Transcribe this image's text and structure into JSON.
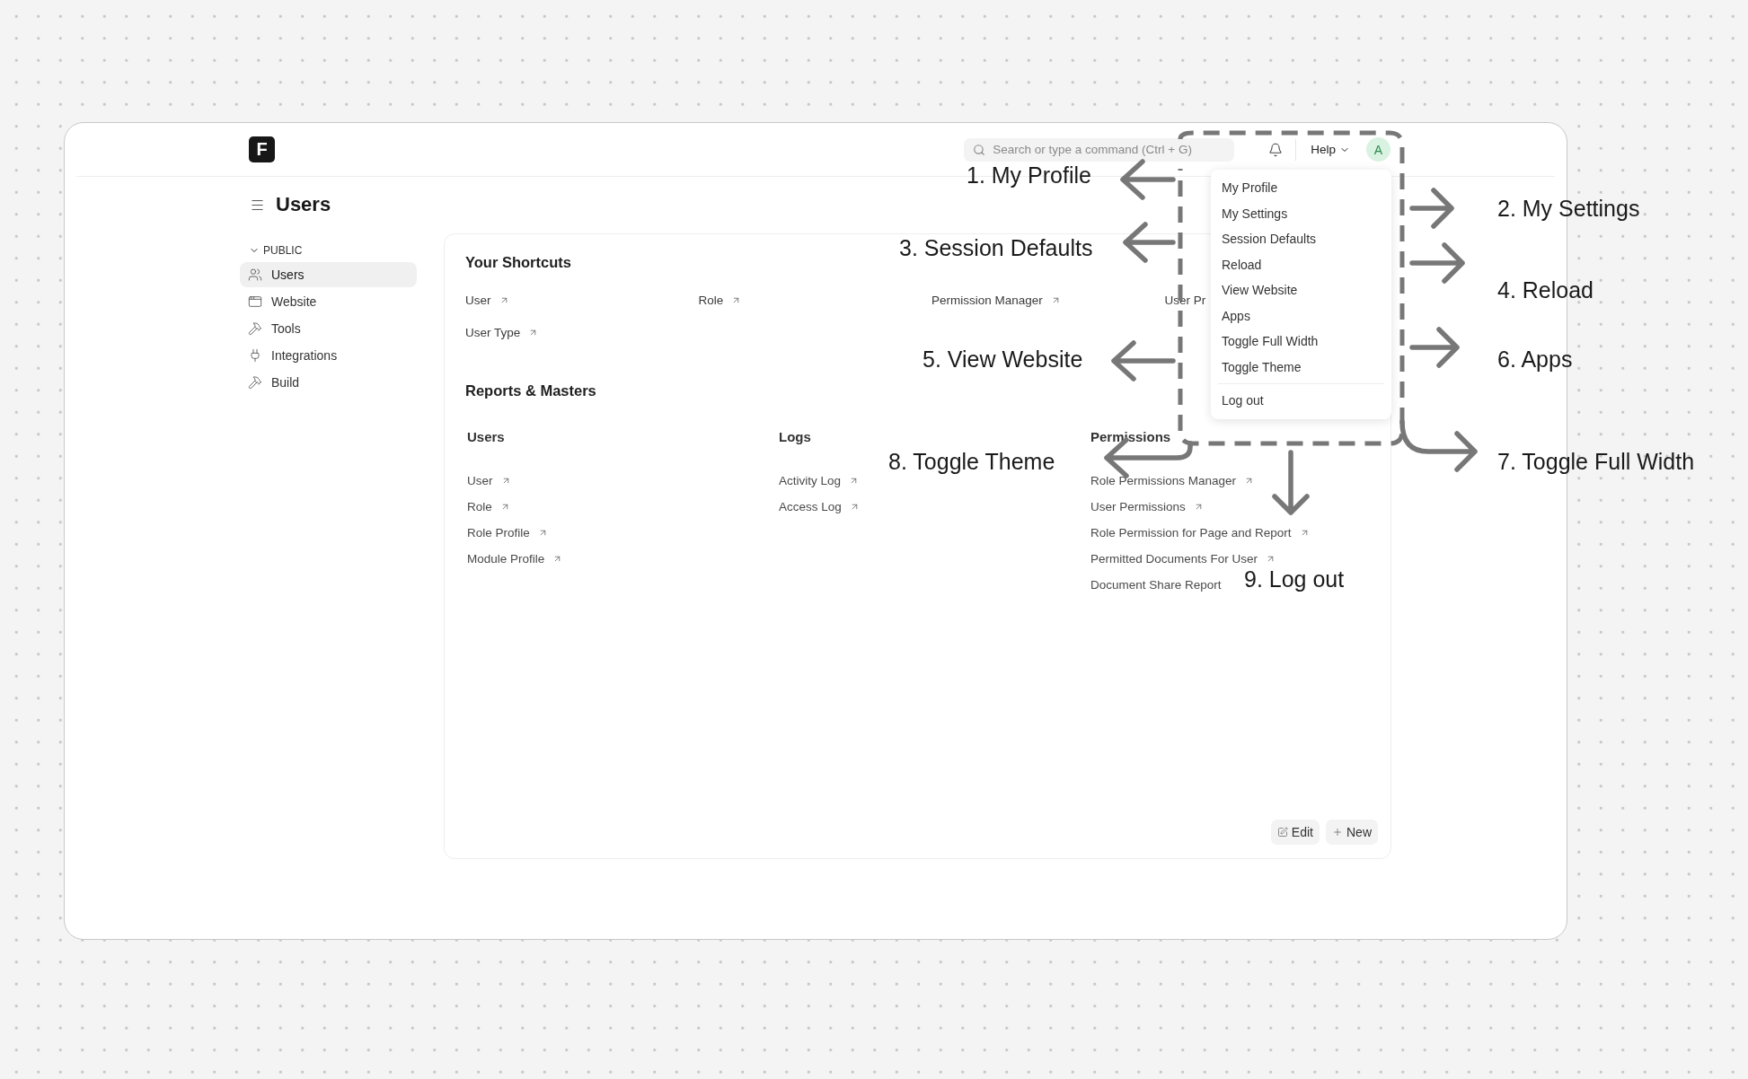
{
  "logo": {
    "letter": "F"
  },
  "search": {
    "placeholder": "Search or type a command (Ctrl + G)"
  },
  "help": {
    "label": "Help"
  },
  "avatar": {
    "initial": "A"
  },
  "page_title": "Users",
  "sidebar": {
    "section": "PUBLIC",
    "expanded": true,
    "items": [
      {
        "label": "Users",
        "selected": true
      },
      {
        "label": "Website",
        "selected": false
      },
      {
        "label": "Tools",
        "selected": false
      },
      {
        "label": "Integrations",
        "selected": false
      },
      {
        "label": "Build",
        "selected": false
      }
    ]
  },
  "shortcuts": {
    "title": "Your Shortcuts",
    "items": [
      {
        "label": "User",
        "arrow": true
      },
      {
        "label": "Role",
        "arrow": true
      },
      {
        "label": "Permission Manager",
        "arrow": true
      },
      {
        "label": "User Pr",
        "arrow": false
      },
      {
        "label": "User Type",
        "arrow": true
      }
    ]
  },
  "reports": {
    "title": "Reports & Masters",
    "columns": [
      {
        "title": "Users",
        "links": [
          {
            "label": "User",
            "arrow": true
          },
          {
            "label": "Role",
            "arrow": true
          },
          {
            "label": "Role Profile",
            "arrow": true
          },
          {
            "label": "Module Profile",
            "arrow": true
          }
        ]
      },
      {
        "title": "Logs",
        "links": [
          {
            "label": "Activity Log",
            "arrow": true
          },
          {
            "label": "Access Log",
            "arrow": true
          }
        ]
      },
      {
        "title": "Permissions",
        "links": [
          {
            "label": "Role Permissions Manager",
            "arrow": true
          },
          {
            "label": "User Permissions",
            "arrow": true
          },
          {
            "label": "Role Permission for Page and Report",
            "arrow": true
          },
          {
            "label": "Permitted Documents For User",
            "arrow": true
          },
          {
            "label": "Document Share Report",
            "arrow": false
          }
        ]
      }
    ]
  },
  "actions": [
    {
      "label": "Edit"
    },
    {
      "label": "New"
    }
  ],
  "user_menu": {
    "open": true,
    "items": [
      {
        "kind": "item",
        "label": "My Profile"
      },
      {
        "kind": "item",
        "label": "My Settings"
      },
      {
        "kind": "item",
        "label": "Session Defaults"
      },
      {
        "kind": "item",
        "label": "Reload"
      },
      {
        "kind": "item",
        "label": "View Website"
      },
      {
        "kind": "item",
        "label": "Apps"
      },
      {
        "kind": "item",
        "label": "Toggle Full Width"
      },
      {
        "kind": "item",
        "label": "Toggle Theme"
      },
      {
        "kind": "divider"
      },
      {
        "kind": "item",
        "label": "Log out"
      }
    ]
  },
  "annotations": [
    {
      "label": "1. My Profile"
    },
    {
      "label": "2. My Settings"
    },
    {
      "label": "3. Session Defaults"
    },
    {
      "label": "4. Reload"
    },
    {
      "label": "5. View Website"
    },
    {
      "label": "6. Apps"
    },
    {
      "label": "8. Toggle Theme"
    },
    {
      "label": "7. Toggle Full Width"
    },
    {
      "label": "9. Log out"
    }
  ]
}
